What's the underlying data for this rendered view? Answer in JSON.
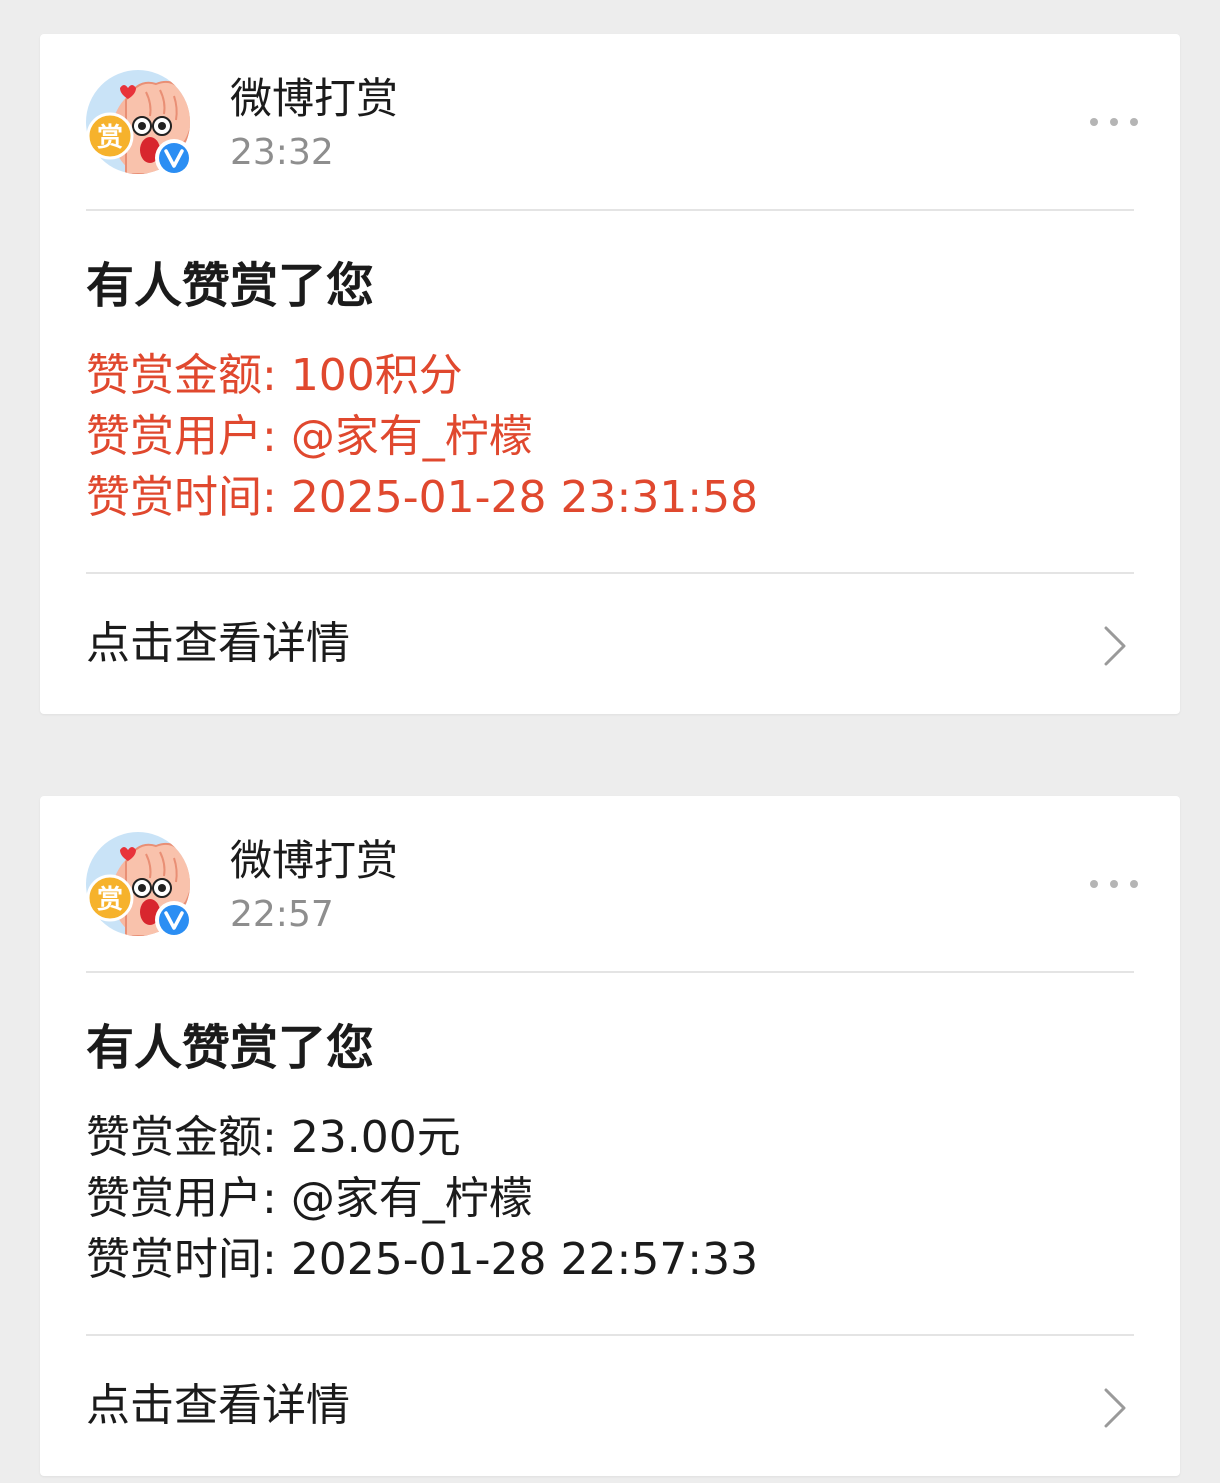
{
  "cards": [
    {
      "sender": {
        "name": "微博打赏",
        "time": "23:32",
        "avatar_badge_text": "赏",
        "avatar_icon": "shang-mascot-avatar",
        "verified_icon": "verified-v-icon"
      },
      "more_icon": "more-dots-icon",
      "message": {
        "title": "有人赞赏了您",
        "highlight_color": "#e0482e",
        "lines": [
          {
            "key": "赞赏金额",
            "value": "100积分"
          },
          {
            "key": "赞赏用户",
            "value": "@家有_柠檬"
          },
          {
            "key": "赞赏时间",
            "value": "2025-01-28 23:31:58"
          }
        ]
      },
      "action": {
        "label": "点击查看详情",
        "icon": "chevron-right-icon"
      }
    },
    {
      "sender": {
        "name": "微博打赏",
        "time": "22:57",
        "avatar_badge_text": "赏",
        "avatar_icon": "shang-mascot-avatar",
        "verified_icon": "verified-v-icon"
      },
      "more_icon": "more-dots-icon",
      "message": {
        "title": "有人赞赏了您",
        "text_color": "#1b1b1b",
        "lines": [
          {
            "key": "赞赏金额",
            "value": "23.00元"
          },
          {
            "key": "赞赏用户",
            "value": "@家有_柠檬"
          },
          {
            "key": "赞赏时间",
            "value": "2025-01-28 22:57:33"
          }
        ]
      },
      "action": {
        "label": "点击查看详情",
        "icon": "chevron-right-icon"
      }
    }
  ],
  "colors": {
    "page_background": "#ededed",
    "card_background": "#ffffff",
    "highlight_red": "#e0482e",
    "verified_blue": "#2b8ef3",
    "badge_orange": "#f6b22c"
  }
}
